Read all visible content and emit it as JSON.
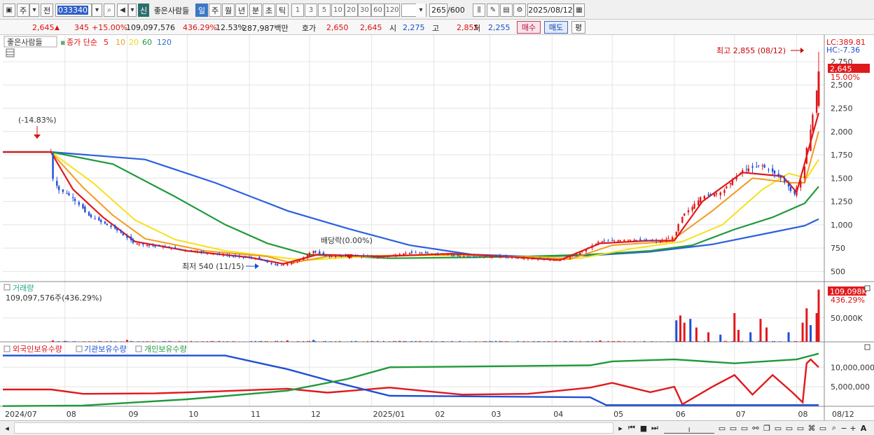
{
  "toolbar": {
    "market_label": "주",
    "prev_label": "전",
    "code": "033340",
    "badge_new": "신",
    "stock_name": "좋은사람들",
    "periods": [
      "일",
      "주",
      "월",
      "년",
      "분",
      "초",
      "틱"
    ],
    "selected_period": "일",
    "intervals": [
      "1",
      "3",
      "5",
      "10",
      "20",
      "30",
      "60",
      "120"
    ],
    "count_value": "265",
    "count_total": "/600",
    "date": "2025/08/12"
  },
  "info": {
    "price": "2,645",
    "change": "345",
    "change_pct": "+15.00%",
    "volume": "109,097,576",
    "volume_pct": "436.29%",
    "turnover": "12.53%",
    "amount": "287,987백만",
    "quote_label": "호가",
    "ask": "2,650",
    "bid": "2,645",
    "open_label": "시",
    "open": "2,275",
    "high_label": "고",
    "high": "2,855",
    "low_label": "저",
    "low": "2,255",
    "buy_label": "매수",
    "sell_label": "매도",
    "avg_label": "평"
  },
  "legend": {
    "name": "좋은사람들",
    "ma_label": "종가 단순",
    "ma_periods": [
      "5",
      "10",
      "20",
      "60",
      "120"
    ]
  },
  "price_labels": {
    "lc": "LC:389.81",
    "hc": "HC:-7.36",
    "current": "2,645",
    "current_pct": "15.00%",
    "high_note": "최고 2,855 (08/12)",
    "low_note": "최저 540 (11/15)",
    "drop_note": "(-14.83%)",
    "dividend_note": "배당락(0.00%)"
  },
  "volume_panel": {
    "title": "거래량",
    "summary": "109,097,576주(436.29%)",
    "current": "109,098K",
    "current_pct": "436.29%"
  },
  "holders_panel": {
    "legend": [
      "외국인보유수량",
      "기관보유수량",
      "개인보유수량"
    ]
  },
  "colors": {
    "up": "#e0191c",
    "down": "#1f4fd8",
    "ma5": "#e0191c",
    "ma10": "#f39a1e",
    "ma20": "#f5e11a",
    "ma60": "#1f9a3a",
    "ma120": "#2b5fe0"
  },
  "chart_data": [
    {
      "type": "candlestick",
      "title": "좋은사람들",
      "y_ticks": [
        "2,750",
        "2,500",
        "2,250",
        "2,000",
        "1,750",
        "1,500",
        "1,250",
        "1,000",
        "750",
        "500"
      ],
      "ylim": [
        390,
        2870
      ],
      "x_ticks": [
        "2024/07",
        "08",
        "09",
        "10",
        "11",
        "12",
        "2025/01",
        "02",
        "03",
        "04",
        "05",
        "06",
        "07",
        "08",
        "08/12"
      ],
      "x_range": [
        "2024-07-01",
        "2025-08-12"
      ],
      "series": [
        {
          "name": "종가",
          "points": [
            [
              "2024-07-01",
              1780
            ],
            [
              "2024-07-25",
              1780
            ],
            [
              "2024-07-26",
              1520
            ],
            [
              "2024-07-29",
              1380
            ],
            [
              "2024-08-05",
              1300
            ],
            [
              "2024-08-13",
              1100
            ],
            [
              "2024-08-27",
              950
            ],
            [
              "2024-09-05",
              800
            ],
            [
              "2024-09-20",
              760
            ],
            [
              "2024-10-10",
              700
            ],
            [
              "2024-10-25",
              660
            ],
            [
              "2024-11-05",
              640
            ],
            [
              "2024-11-15",
              560
            ],
            [
              "2024-11-25",
              600
            ],
            [
              "2024-12-03",
              720
            ],
            [
              "2024-12-10",
              660
            ],
            [
              "2024-12-24",
              670
            ],
            [
              "2025-01-05",
              650
            ],
            [
              "2025-01-20",
              700
            ],
            [
              "2025-02-05",
              690
            ],
            [
              "2025-02-20",
              650
            ],
            [
              "2025-03-05",
              660
            ],
            [
              "2025-03-20",
              640
            ],
            [
              "2025-04-05",
              620
            ],
            [
              "2025-04-15",
              700
            ],
            [
              "2025-04-25",
              820
            ],
            [
              "2025-05-10",
              840
            ],
            [
              "2025-05-25",
              820
            ],
            [
              "2025-06-01",
              870
            ],
            [
              "2025-06-05",
              1080
            ],
            [
              "2025-06-15",
              1300
            ],
            [
              "2025-06-25",
              1350
            ],
            [
              "2025-07-05",
              1580
            ],
            [
              "2025-07-15",
              1640
            ],
            [
              "2025-07-25",
              1500
            ],
            [
              "2025-07-31",
              1320
            ],
            [
              "2025-08-04",
              1500
            ],
            [
              "2025-08-08",
              2000
            ],
            [
              "2025-08-11",
              2300
            ],
            [
              "2025-08-12",
              2645
            ]
          ]
        },
        {
          "name": "5",
          "points": [
            [
              "2024-07-01",
              1780
            ],
            [
              "2024-07-25",
              1780
            ],
            [
              "2024-08-05",
              1380
            ],
            [
              "2024-08-20",
              1080
            ],
            [
              "2024-09-05",
              820
            ],
            [
              "2024-10-01",
              720
            ],
            [
              "2024-11-01",
              650
            ],
            [
              "2024-11-18",
              580
            ],
            [
              "2024-12-05",
              680
            ],
            [
              "2025-01-05",
              660
            ],
            [
              "2025-02-10",
              690
            ],
            [
              "2025-03-15",
              650
            ],
            [
              "2025-04-05",
              620
            ],
            [
              "2025-04-25",
              800
            ],
            [
              "2025-05-20",
              830
            ],
            [
              "2025-06-01",
              830
            ],
            [
              "2025-06-15",
              1250
            ],
            [
              "2025-07-05",
              1560
            ],
            [
              "2025-07-25",
              1520
            ],
            [
              "2025-08-01",
              1350
            ],
            [
              "2025-08-12",
              2200
            ]
          ]
        },
        {
          "name": "10",
          "points": [
            [
              "2024-07-01",
              1780
            ],
            [
              "2024-07-25",
              1780
            ],
            [
              "2024-08-10",
              1400
            ],
            [
              "2024-08-25",
              1100
            ],
            [
              "2024-09-10",
              850
            ],
            [
              "2024-10-10",
              720
            ],
            [
              "2024-11-10",
              660
            ],
            [
              "2024-11-22",
              590
            ],
            [
              "2024-12-10",
              660
            ],
            [
              "2025-01-10",
              670
            ],
            [
              "2025-02-15",
              680
            ],
            [
              "2025-03-20",
              650
            ],
            [
              "2025-04-10",
              630
            ],
            [
              "2025-05-01",
              780
            ],
            [
              "2025-05-30",
              820
            ],
            [
              "2025-06-20",
              1150
            ],
            [
              "2025-07-10",
              1500
            ],
            [
              "2025-07-30",
              1450
            ],
            [
              "2025-08-05",
              1450
            ],
            [
              "2025-08-12",
              2000
            ]
          ]
        },
        {
          "name": "20",
          "points": [
            [
              "2024-07-01",
              1780
            ],
            [
              "2024-07-25",
              1780
            ],
            [
              "2024-08-15",
              1450
            ],
            [
              "2024-09-05",
              1050
            ],
            [
              "2024-09-25",
              840
            ],
            [
              "2024-10-20",
              720
            ],
            [
              "2024-11-20",
              640
            ],
            [
              "2024-11-30",
              620
            ],
            [
              "2024-12-20",
              650
            ],
            [
              "2025-01-20",
              670
            ],
            [
              "2025-02-20",
              670
            ],
            [
              "2025-03-20",
              655
            ],
            [
              "2025-04-15",
              640
            ],
            [
              "2025-05-10",
              740
            ],
            [
              "2025-06-05",
              820
            ],
            [
              "2025-06-25",
              1000
            ],
            [
              "2025-07-15",
              1380
            ],
            [
              "2025-07-28",
              1550
            ],
            [
              "2025-08-06",
              1500
            ],
            [
              "2025-08-12",
              1700
            ]
          ]
        },
        {
          "name": "60",
          "points": [
            [
              "2024-07-01",
              1780
            ],
            [
              "2024-07-25",
              1780
            ],
            [
              "2024-08-25",
              1650
            ],
            [
              "2024-09-25",
              1300
            ],
            [
              "2024-10-20",
              1000
            ],
            [
              "2024-11-10",
              800
            ],
            [
              "2024-11-30",
              680
            ],
            [
              "2025-01-10",
              640
            ],
            [
              "2025-02-20",
              650
            ],
            [
              "2025-03-20",
              660
            ],
            [
              "2025-04-20",
              680
            ],
            [
              "2025-05-20",
              720
            ],
            [
              "2025-06-10",
              780
            ],
            [
              "2025-07-01",
              950
            ],
            [
              "2025-07-20",
              1080
            ],
            [
              "2025-08-05",
              1230
            ],
            [
              "2025-08-12",
              1410
            ]
          ]
        },
        {
          "name": "120",
          "points": [
            [
              "2024-07-01",
              1780
            ],
            [
              "2024-07-25",
              1780
            ],
            [
              "2024-09-10",
              1700
            ],
            [
              "2024-10-15",
              1450
            ],
            [
              "2024-11-20",
              1150
            ],
            [
              "2024-12-20",
              960
            ],
            [
              "2025-01-20",
              780
            ],
            [
              "2025-02-20",
              680
            ],
            [
              "2025-03-20",
              660
            ],
            [
              "2025-04-20",
              670
            ],
            [
              "2025-05-20",
              710
            ],
            [
              "2025-06-20",
              790
            ],
            [
              "2025-07-20",
              920
            ],
            [
              "2025-08-05",
              990
            ],
            [
              "2025-08-12",
              1060
            ]
          ]
        }
      ]
    },
    {
      "type": "bar",
      "title": "거래량",
      "y_ticks": [
        "50,000K"
      ],
      "ylim": [
        0,
        120000
      ],
      "bars": [
        [
          "2024-07-26",
          3000
        ],
        [
          "2024-08-01",
          2000
        ],
        [
          "2024-09-01",
          4000
        ],
        [
          "2024-11-20",
          3000
        ],
        [
          "2024-12-03",
          4000
        ],
        [
          "2025-01-15",
          2000
        ],
        [
          "2025-04-25",
          3000
        ],
        [
          "2025-06-02",
          45000
        ],
        [
          "2025-06-04",
          55000
        ],
        [
          "2025-06-06",
          40000
        ],
        [
          "2025-06-09",
          48000
        ],
        [
          "2025-06-12",
          30000
        ],
        [
          "2025-06-18",
          20000
        ],
        [
          "2025-06-24",
          15000
        ],
        [
          "2025-07-01",
          60000
        ],
        [
          "2025-07-03",
          25000
        ],
        [
          "2025-07-09",
          20000
        ],
        [
          "2025-07-14",
          48000
        ],
        [
          "2025-07-17",
          30000
        ],
        [
          "2025-07-28",
          20000
        ],
        [
          "2025-08-04",
          40000
        ],
        [
          "2025-08-06",
          70000
        ],
        [
          "2025-08-08",
          35000
        ],
        [
          "2025-08-11",
          60000
        ],
        [
          "2025-08-12",
          109098
        ]
      ]
    },
    {
      "type": "line",
      "title": "보유수량",
      "y_ticks": [
        "10,000,000",
        "5,000,000"
      ],
      "ylim": [
        0,
        14000000
      ],
      "series": [
        {
          "name": "외국인보유수량",
          "points": [
            [
              "2024-07-01",
              4300000
            ],
            [
              "2024-07-25",
              4300000
            ],
            [
              "2024-08-10",
              3200000
            ],
            [
              "2024-09-15",
              3300000
            ],
            [
              "2024-10-15",
              3800000
            ],
            [
              "2024-11-20",
              4500000
            ],
            [
              "2024-12-10",
              3500000
            ],
            [
              "2025-01-10",
              4800000
            ],
            [
              "2025-02-15",
              3000000
            ],
            [
              "2025-03-20",
              3200000
            ],
            [
              "2025-04-20",
              4800000
            ],
            [
              "2025-05-01",
              6000000
            ],
            [
              "2025-05-20",
              3600000
            ],
            [
              "2025-06-01",
              5000000
            ],
            [
              "2025-06-05",
              500000
            ],
            [
              "2025-06-20",
              5000000
            ],
            [
              "2025-07-01",
              8000000
            ],
            [
              "2025-07-10",
              3000000
            ],
            [
              "2025-07-20",
              8000000
            ],
            [
              "2025-07-30",
              3500000
            ],
            [
              "2025-08-04",
              1000000
            ],
            [
              "2025-08-06",
              11000000
            ],
            [
              "2025-08-08",
              12000000
            ],
            [
              "2025-08-12",
              10000000
            ]
          ]
        },
        {
          "name": "기관보유수량",
          "points": [
            [
              "2024-07-01",
              13000000
            ],
            [
              "2024-10-20",
              13000000
            ],
            [
              "2024-11-20",
              9500000
            ],
            [
              "2024-12-15",
              6000000
            ],
            [
              "2025-01-10",
              2700000
            ],
            [
              "2025-04-20",
              2300000
            ],
            [
              "2025-04-28",
              300000
            ],
            [
              "2025-08-12",
              300000
            ]
          ]
        },
        {
          "name": "개인보유수량",
          "points": [
            [
              "2024-07-01",
              50000
            ],
            [
              "2024-08-10",
              200000
            ],
            [
              "2024-10-01",
              1800000
            ],
            [
              "2024-11-20",
              4000000
            ],
            [
              "2024-12-20",
              7000000
            ],
            [
              "2025-01-10",
              10000000
            ],
            [
              "2025-04-20",
              10500000
            ],
            [
              "2025-05-01",
              11500000
            ],
            [
              "2025-06-01",
              12000000
            ],
            [
              "2025-07-01",
              11000000
            ],
            [
              "2025-08-01",
              12000000
            ],
            [
              "2025-08-12",
              13500000
            ]
          ]
        }
      ]
    }
  ]
}
